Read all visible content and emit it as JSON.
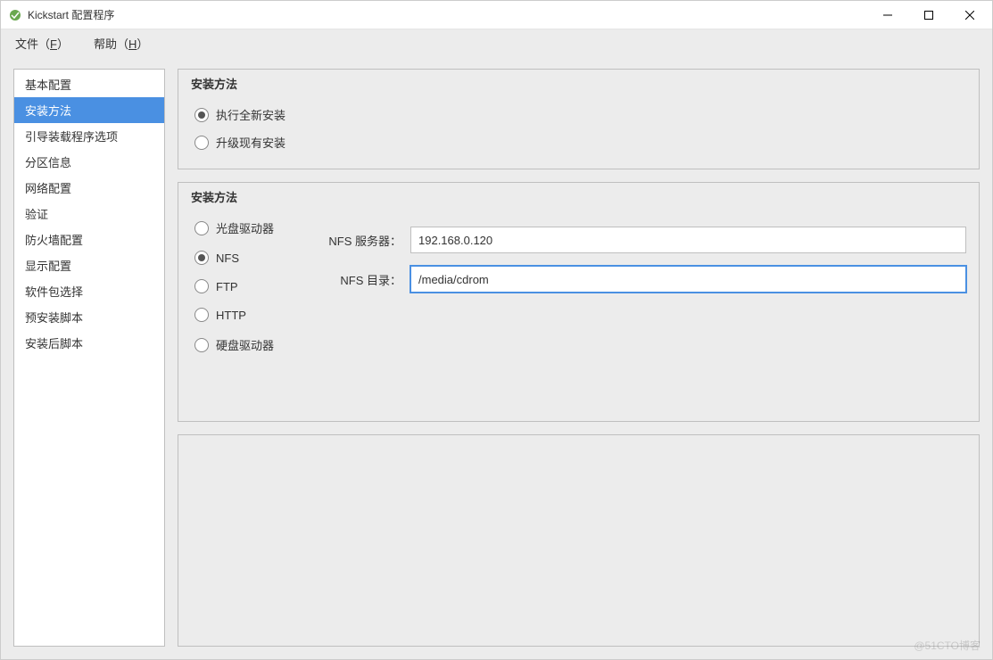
{
  "window": {
    "title": "Kickstart 配置程序"
  },
  "menu": {
    "file": "文件（",
    "file_mnemonic": "F",
    "file_suffix": "）",
    "help": "帮助（",
    "help_mnemonic": "H",
    "help_suffix": "）"
  },
  "sidebar": {
    "items": [
      "基本配置",
      "安装方法",
      "引导装载程序选项",
      "分区信息",
      "网络配置",
      "验证",
      "防火墙配置",
      "显示配置",
      "软件包选择",
      "预安装脚本",
      "安装后脚本"
    ],
    "selected_index": 1
  },
  "install_type": {
    "title": "安装方法",
    "options": {
      "fresh": "执行全新安装",
      "upgrade": "升级现有安装"
    },
    "selected": "fresh"
  },
  "install_method": {
    "title": "安装方法",
    "options": {
      "cdrom": "光盘驱动器",
      "nfs": "NFS",
      "ftp": "FTP",
      "http": "HTTP",
      "hd": "硬盘驱动器"
    },
    "selected": "nfs",
    "fields": {
      "nfs_server_label": "NFS 服务器：",
      "nfs_server_value": "192.168.0.120",
      "nfs_dir_label": "NFS 目录：",
      "nfs_dir_value": "/media/cdrom"
    }
  },
  "watermark": "@51CTO博客"
}
